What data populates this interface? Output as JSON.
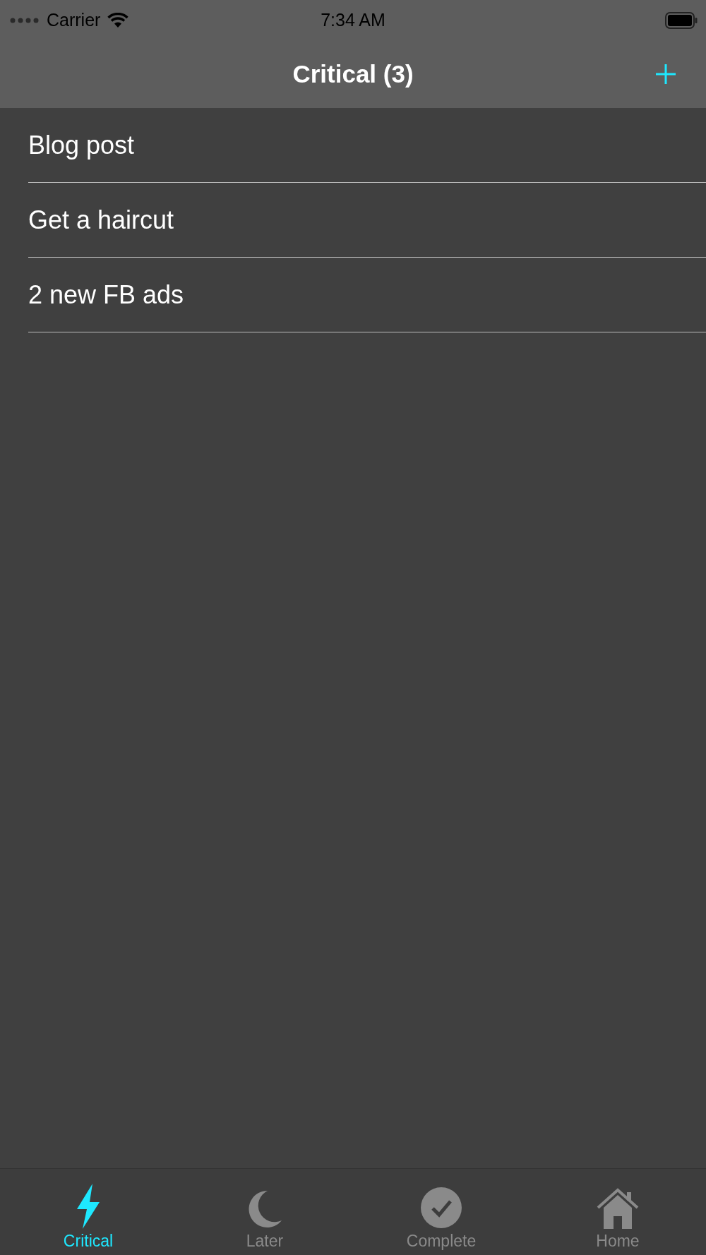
{
  "status_bar": {
    "carrier": "Carrier",
    "time": "7:34 AM"
  },
  "nav_bar": {
    "title": "Critical (3)"
  },
  "tasks": [
    {
      "title": "Blog post"
    },
    {
      "title": "Get a haircut"
    },
    {
      "title": "2 new FB ads"
    }
  ],
  "tab_bar": [
    {
      "label": "Critical",
      "kind": "bolt",
      "selected": true
    },
    {
      "label": "Later",
      "kind": "moon",
      "selected": false
    },
    {
      "label": "Complete",
      "kind": "check",
      "selected": false
    },
    {
      "label": "Home",
      "kind": "house",
      "selected": false
    }
  ]
}
